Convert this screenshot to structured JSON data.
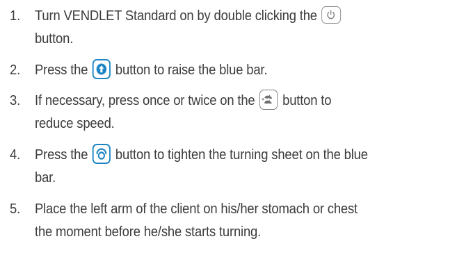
{
  "steps": [
    {
      "number": "1.",
      "line1_before": "Turn VENDLET Standard on by double clicking the ",
      "icon": "power-icon",
      "line2": "button."
    },
    {
      "number": "2.",
      "before": "Press the ",
      "icon": "arrow-up-icon",
      "after": " button to raise the blue bar."
    },
    {
      "number": "3.",
      "line1_before": "If necessary, press once or twice on the ",
      "icon": "slow-speed-icon",
      "line1_after": " button to",
      "line2": "reduce speed."
    },
    {
      "number": "4.",
      "line1_before": "Press the ",
      "icon": "tighten-sheet-icon",
      "line1_after": " button to tighten the turning sheet on the blue",
      "line2": "bar."
    },
    {
      "number": "5.",
      "line1": "Place the left arm of the client on his/her stomach or chest",
      "line2": "the moment before he/she starts turning."
    }
  ],
  "colors": {
    "text": "#3c3c3c",
    "accent_blue": "#1a84c4",
    "icon_gray": "#8a8a8a"
  }
}
